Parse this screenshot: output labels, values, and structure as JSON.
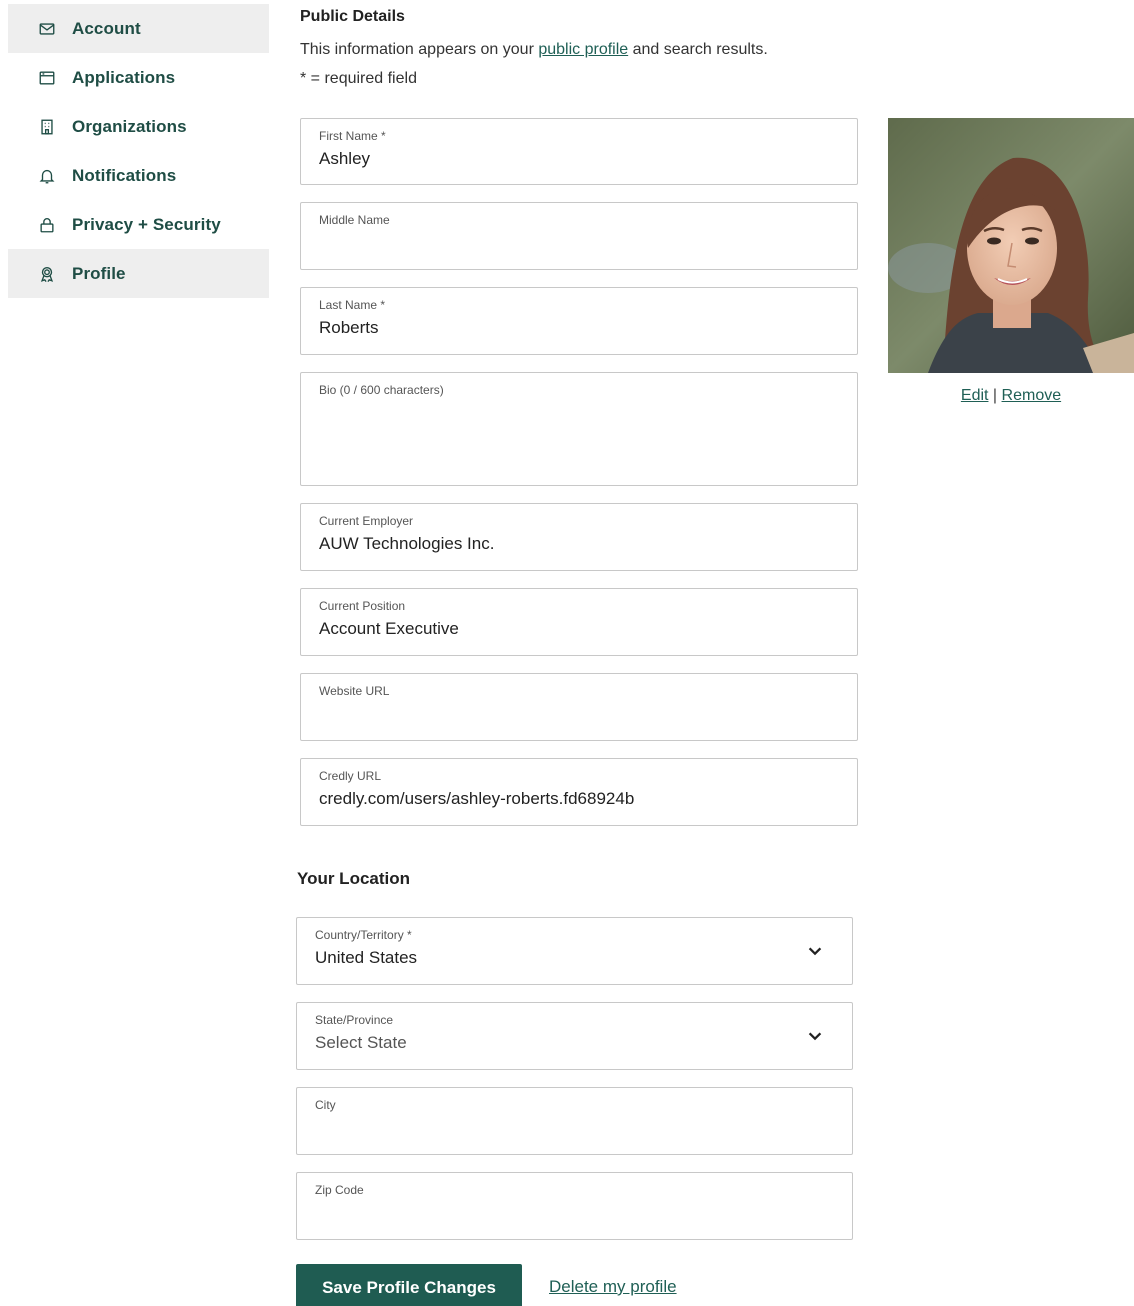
{
  "sidebar": {
    "items": [
      {
        "label": "Account",
        "icon": "mail-icon",
        "active": true
      },
      {
        "label": "Applications",
        "icon": "window-icon",
        "active": false
      },
      {
        "label": "Organizations",
        "icon": "building-icon",
        "active": false
      },
      {
        "label": "Notifications",
        "icon": "bell-icon",
        "active": false
      },
      {
        "label": "Privacy + Security",
        "icon": "lock-icon",
        "active": false
      },
      {
        "label": "Profile",
        "icon": "badge-icon",
        "active": true
      }
    ]
  },
  "public_details": {
    "title": "Public Details",
    "intro_before": "This information appears on your ",
    "intro_link": "public profile",
    "intro_after": " and search results.",
    "required_note": "* = required field",
    "fields": {
      "first_name": {
        "label": "First Name *",
        "value": "Ashley"
      },
      "middle_name": {
        "label": "Middle Name",
        "value": ""
      },
      "last_name": {
        "label": "Last Name *",
        "value": "Roberts"
      },
      "bio": {
        "label": "Bio (0 / 600 characters)",
        "value": ""
      },
      "employer": {
        "label": "Current Employer",
        "value": "AUW Technologies Inc."
      },
      "position": {
        "label": "Current Position",
        "value": "Account Executive"
      },
      "website": {
        "label": "Website URL",
        "value": ""
      },
      "credly": {
        "label": "Credly URL",
        "value": "credly.com/users/ashley-roberts.fd68924b"
      }
    }
  },
  "photo": {
    "edit_label": "Edit",
    "separator": "|",
    "remove_label": "Remove"
  },
  "location": {
    "title": "Your Location",
    "fields": {
      "country": {
        "label": "Country/Territory *",
        "value": "United States"
      },
      "state": {
        "label": "State/Province",
        "value": "Select State"
      },
      "city": {
        "label": "City",
        "value": ""
      },
      "zip": {
        "label": "Zip Code",
        "value": ""
      }
    }
  },
  "actions": {
    "save_label": "Save Profile Changes",
    "delete_label": "Delete my profile"
  },
  "colors": {
    "accent": "#1f5c52",
    "link": "#1f5f55",
    "sidebar_text": "#1f4d45",
    "sidebar_active_bg": "#eeeeee"
  }
}
